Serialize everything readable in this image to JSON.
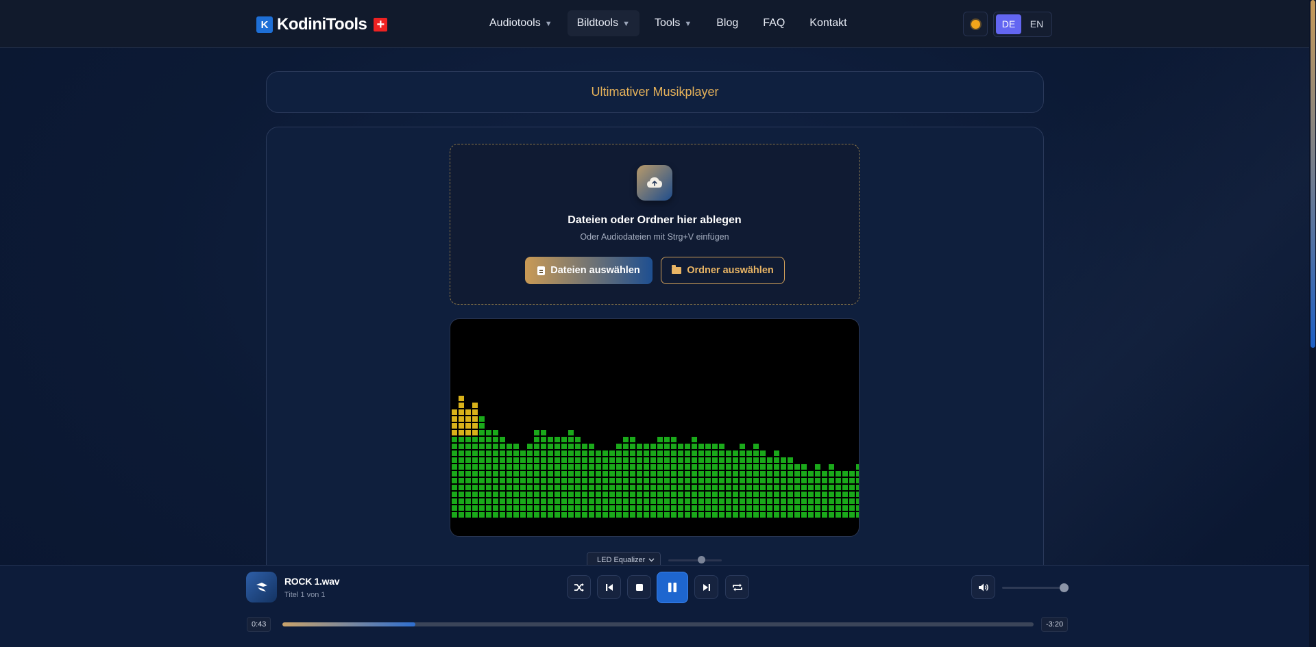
{
  "nav": {
    "logo_text": "KodiniTools",
    "logo_mark": "K",
    "items": [
      {
        "label": "Audiotools",
        "dropdown": true
      },
      {
        "label": "Bildtools",
        "dropdown": true,
        "active": true
      },
      {
        "label": "Tools",
        "dropdown": true
      },
      {
        "label": "Blog"
      },
      {
        "label": "FAQ"
      },
      {
        "label": "Kontakt"
      }
    ],
    "caret": "▼",
    "languages": [
      "DE",
      "EN"
    ],
    "active_language": "DE"
  },
  "page_title": "Ultimativer Musikplayer",
  "dropzone": {
    "title": "Dateien oder Ordner hier ablegen",
    "subtitle": "Oder Audiodateien mit Strg+V einfügen",
    "files_button": "Dateien auswählen",
    "folder_button": "Ordner auswählen"
  },
  "visualizer": {
    "mode_select": "LED Equalizer",
    "bar_levels": [
      16,
      18,
      16,
      17,
      15,
      13,
      13,
      12,
      11,
      11,
      10,
      11,
      13,
      13,
      12,
      12,
      12,
      13,
      12,
      11,
      11,
      10,
      10,
      10,
      11,
      12,
      12,
      11,
      11,
      11,
      12,
      12,
      12,
      11,
      11,
      12,
      11,
      11,
      11,
      11,
      10,
      10,
      11,
      10,
      11,
      10,
      9,
      10,
      9,
      9,
      8,
      8,
      7,
      8,
      7,
      8,
      7,
      7,
      7,
      8
    ],
    "green_color": "#1aa91a",
    "yellow_color": "#d9b21a",
    "yellow_threshold": 16
  },
  "player": {
    "track_name": "ROCK 1.wav",
    "track_sub": "Titel 1 von 1",
    "time_elapsed": "0:43",
    "time_remaining": "-3:20",
    "progress": 0.177,
    "volume": 1.0,
    "accent": "#1e66cf"
  }
}
